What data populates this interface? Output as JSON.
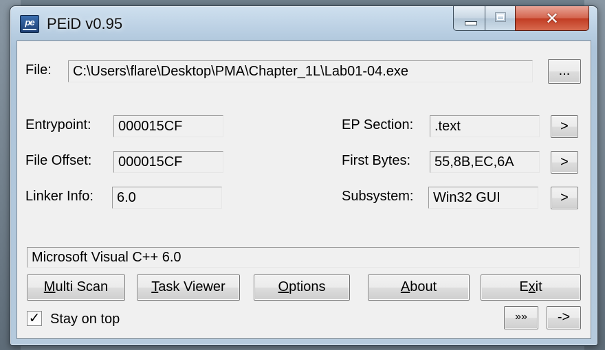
{
  "window": {
    "title": "PEiD v0.95",
    "app_icon_text": "pe"
  },
  "file": {
    "label": "File:",
    "path": "C:\\Users\\flare\\Desktop\\PMA\\Chapter_1L\\Lab01-04.exe",
    "browse_label": "..."
  },
  "fields": {
    "entrypoint": {
      "label": "Entrypoint:",
      "value": "000015CF"
    },
    "file_offset": {
      "label": "File Offset:",
      "value": "000015CF"
    },
    "linker_info": {
      "label": "Linker Info:",
      "value": "6.0"
    },
    "ep_section": {
      "label": "EP Section:",
      "value": ".text",
      "button": ">"
    },
    "first_bytes": {
      "label": "First Bytes:",
      "value": "55,8B,EC,6A",
      "button": ">"
    },
    "subsystem": {
      "label": "Subsystem:",
      "value": "Win32 GUI",
      "button": ">"
    }
  },
  "detection": "Microsoft Visual C++ 6.0",
  "buttons": {
    "multi_scan": {
      "acc": "M",
      "rest": "ulti Scan"
    },
    "task_viewer": {
      "acc": "T",
      "rest": "ask Viewer"
    },
    "options": {
      "acc": "O",
      "rest": "ptions"
    },
    "about": {
      "acc": "A",
      "rest": "bout"
    },
    "exit": {
      "pre": "E",
      "acc": "x",
      "rest": "it"
    }
  },
  "stay_on_top": {
    "pre": "",
    "acc": "S",
    "rest": "tay on top",
    "checked": true,
    "check_glyph": "✓"
  },
  "extra_buttons": {
    "ext": "»»",
    "arrow": "->"
  }
}
